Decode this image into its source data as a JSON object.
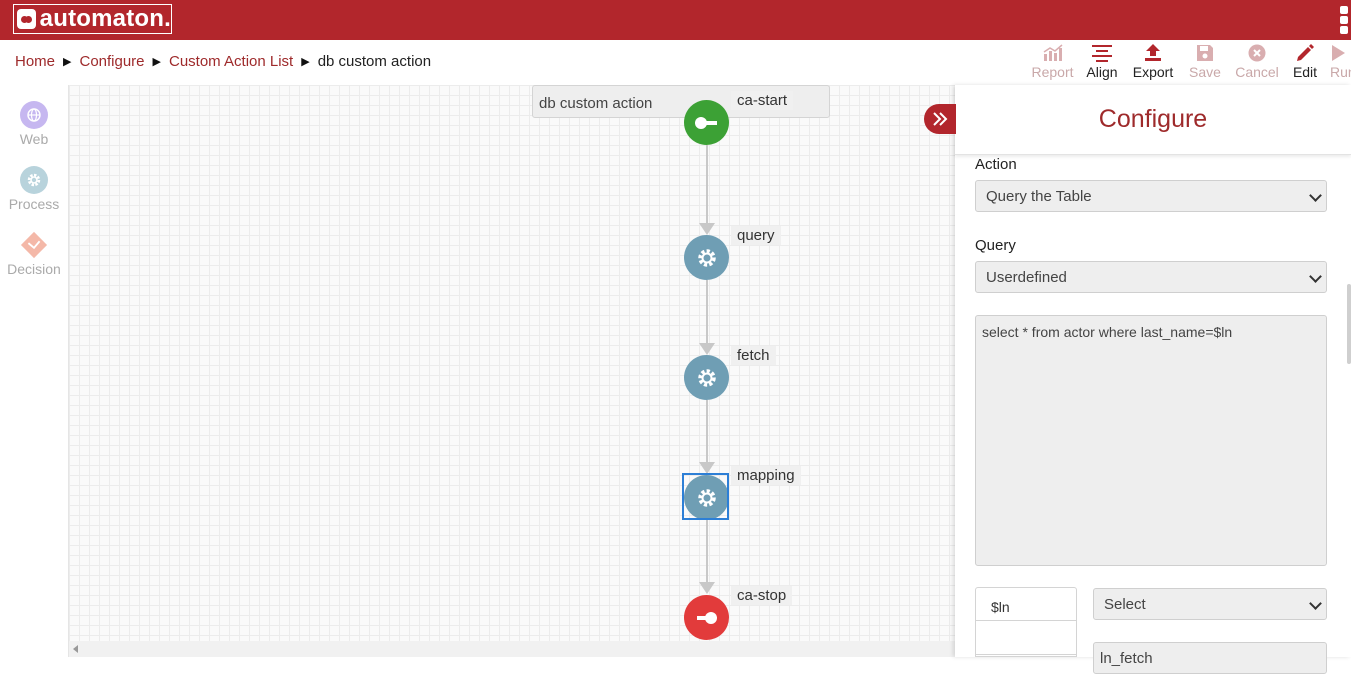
{
  "app": {
    "logo_text": "automaton."
  },
  "breadcrumb": [
    {
      "label": "Home"
    },
    {
      "label": "Configure"
    },
    {
      "label": "Custom Action List"
    },
    {
      "label": "db custom action"
    }
  ],
  "toolbar": {
    "report": "Report",
    "align": "Align",
    "export": "Export",
    "save": "Save",
    "cancel": "Cancel",
    "edit": "Edit",
    "run": "Run"
  },
  "palette": {
    "web": "Web",
    "process": "Process",
    "decision": "Decision"
  },
  "canvas": {
    "title": "db custom action",
    "nodes": [
      {
        "label": "ca-start",
        "type": "start"
      },
      {
        "label": "query",
        "type": "process"
      },
      {
        "label": "fetch",
        "type": "process"
      },
      {
        "label": "mapping",
        "type": "process",
        "selected": true
      },
      {
        "label": "ca-stop",
        "type": "stop"
      }
    ]
  },
  "panel": {
    "title": "Configure",
    "action_label": "Action",
    "action_value": "Query the Table",
    "query_label": "Query",
    "query_value": "Userdefined",
    "query_text": "select * from actor where last_name=$ln",
    "param_name": "$ln",
    "param_select": "Select",
    "param_value_partial": "ln_fetch"
  },
  "colors": {
    "brand": "#b2262c",
    "start_node": "#3ca135",
    "process_node": "#6f9eb4",
    "stop_node": "#e23b3b",
    "selection": "#2d7fd6"
  }
}
